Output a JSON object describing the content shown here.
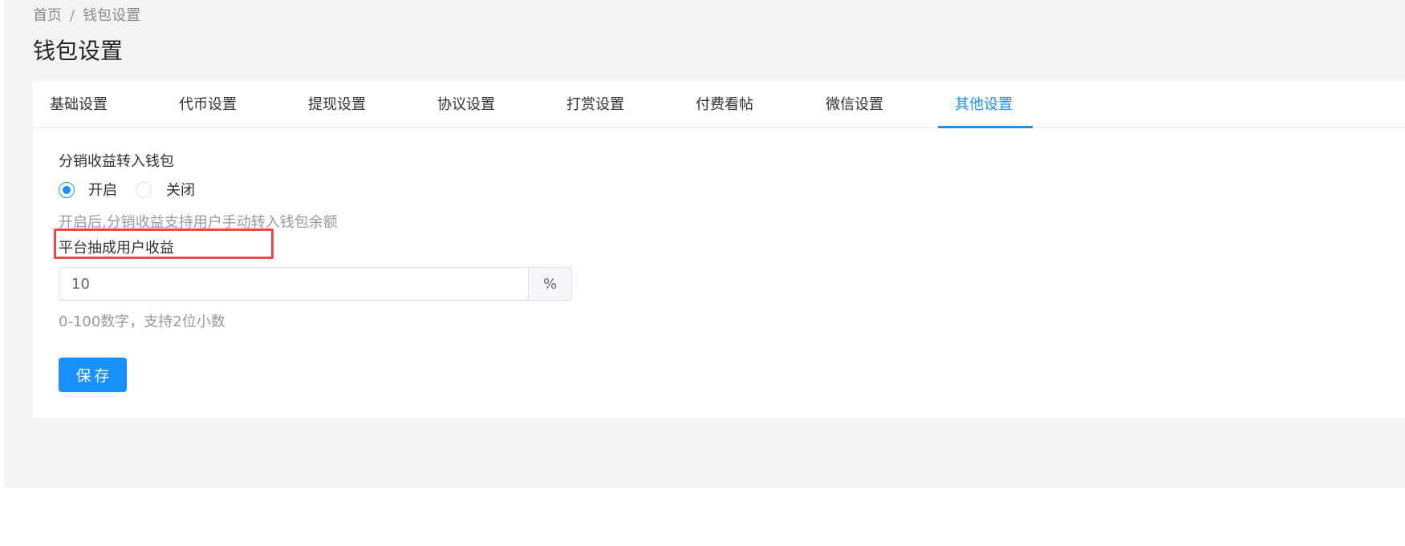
{
  "breadcrumb": {
    "home": "首页",
    "separator": "/",
    "current": "钱包设置"
  },
  "page_title": "钱包设置",
  "tabs": [
    {
      "label": "基础设置",
      "active": false
    },
    {
      "label": "代币设置",
      "active": false
    },
    {
      "label": "提现设置",
      "active": false
    },
    {
      "label": "协议设置",
      "active": false
    },
    {
      "label": "打赏设置",
      "active": false
    },
    {
      "label": "付费看帖",
      "active": false
    },
    {
      "label": "微信设置",
      "active": false
    },
    {
      "label": "其他设置",
      "active": true
    }
  ],
  "form": {
    "distribution": {
      "label": "分销收益转入钱包",
      "options": [
        {
          "label": "开启",
          "checked": true
        },
        {
          "label": "关闭",
          "checked": false
        }
      ],
      "hint": "开启后,分销收益支持用户手动转入钱包余额"
    },
    "commission": {
      "label": "平台抽成用户收益",
      "value": "10",
      "suffix": "%",
      "hint": "0-100数字，支持2位小数"
    },
    "save_label": "保存"
  },
  "colors": {
    "accent": "#1890ff",
    "highlight": "#f04747",
    "background": "#f4f4f4"
  }
}
